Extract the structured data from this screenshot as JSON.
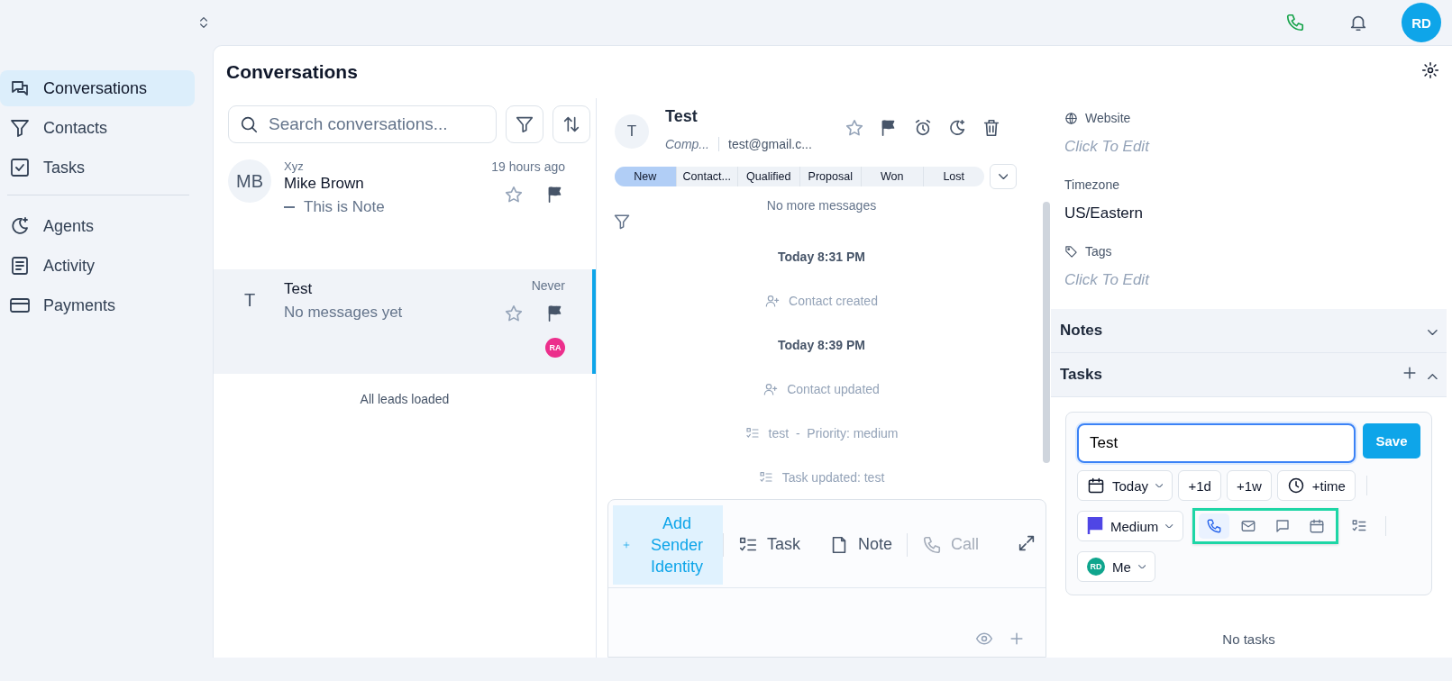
{
  "top_bar": {
    "avatar": "RD"
  },
  "sidebar": {
    "groups": [
      [
        {
          "label": "Conversations",
          "selected": true
        },
        {
          "label": "Contacts",
          "selected": false
        },
        {
          "label": "Tasks",
          "selected": false
        }
      ],
      [
        {
          "label": "Agents",
          "selected": false
        },
        {
          "label": "Activity",
          "selected": false
        },
        {
          "label": "Payments",
          "selected": false
        }
      ]
    ]
  },
  "page": {
    "title": "Conversations"
  },
  "search": {
    "placeholder": "Search conversations..."
  },
  "conversations": [
    {
      "avatar": "MB",
      "company": "Xyz",
      "name": "Mike Brown",
      "preview": "This is Note",
      "kind": "note",
      "time": "19 hours ago",
      "selected": false
    },
    {
      "avatar": "T",
      "name": "Test",
      "preview": "No messages yet",
      "kind": "message",
      "time": "Never",
      "selected": true,
      "assignee": {
        "initials": "RA",
        "color": "#ec2f8c"
      }
    }
  ],
  "list_footer": "All leads loaded",
  "contact": {
    "avatar": "T",
    "name": "Test",
    "company": "Comp...",
    "email": "test@gmail.c..."
  },
  "stages": [
    {
      "label": "New",
      "selected": true
    },
    {
      "label": "Contact...",
      "selected": false
    },
    {
      "label": "Qualified",
      "selected": false
    },
    {
      "label": "Proposal",
      "selected": false
    },
    {
      "label": "Won",
      "selected": false
    },
    {
      "label": "Lost",
      "selected": false
    }
  ],
  "timeline": {
    "notice": "No more messages",
    "events": [
      {
        "kind": "date",
        "text": "Today 8:31 PM"
      },
      {
        "kind": "contact",
        "text": "Contact created"
      },
      {
        "kind": "date",
        "text": "Today 8:39 PM"
      },
      {
        "kind": "contact",
        "text": "Contact updated"
      },
      {
        "kind": "task",
        "text": "test  -  Priority: medium"
      },
      {
        "kind": "task",
        "text": "Task updated: test"
      }
    ]
  },
  "composer": {
    "tabs": [
      {
        "kind": "sender",
        "label": "Add Sender Identity",
        "selected": true,
        "disabled": false
      },
      {
        "kind": "task",
        "label": "Task",
        "selected": false,
        "disabled": false
      },
      {
        "kind": "note",
        "label": "Note",
        "selected": false,
        "disabled": false
      },
      {
        "kind": "call",
        "label": "Call",
        "selected": false,
        "disabled": true
      }
    ]
  },
  "details": {
    "fields": [
      {
        "kind": "link",
        "label": "Website",
        "value": "Click To Edit",
        "empty": true
      },
      {
        "kind": "plain",
        "label": "Timezone",
        "value": "US/Eastern",
        "empty": false
      },
      {
        "kind": "tags",
        "label": "Tags",
        "value": "Click To Edit",
        "empty": true
      }
    ],
    "sections": [
      {
        "title": "Notes",
        "expanded": false
      },
      {
        "title": "Tasks",
        "expanded": true,
        "can_add": true
      }
    ]
  },
  "task_form": {
    "value": "Test",
    "save": "Save",
    "due": "Today",
    "shortcuts": [
      "+1d",
      "+1w"
    ],
    "time": "+time",
    "priority": {
      "label": "Medium",
      "color": "#4f46e5"
    },
    "type_group": {
      "highlighted": true,
      "types": [
        {
          "kind": "call",
          "selected": true
        },
        {
          "kind": "email",
          "selected": false
        },
        {
          "kind": "chat",
          "selected": false
        },
        {
          "kind": "meeting",
          "selected": false
        }
      ]
    },
    "assignee": {
      "initials": "RD",
      "label": "Me",
      "color": "#0fa58d"
    }
  },
  "tasks_empty": "No tasks"
}
